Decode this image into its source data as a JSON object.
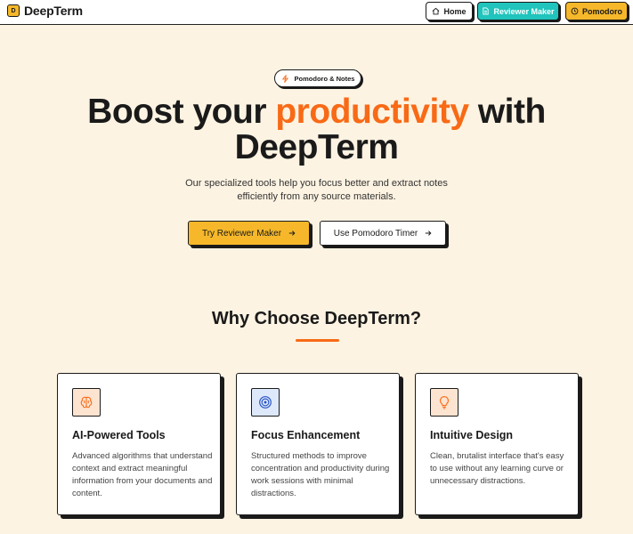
{
  "header": {
    "logo_text": "DeepTerm",
    "logo_mark": "D",
    "nav": {
      "home_label": "Home",
      "reviewer_label": "Reviewer Maker",
      "pomodoro_label": "Pomodoro"
    }
  },
  "hero": {
    "pill_label": "Pomodoro & Notes",
    "title_part1": "Boost your ",
    "title_accent": "productivity",
    "title_part2": " with",
    "title_line2": "DeepTerm",
    "subtitle": "Our specialized tools help you focus better and extract notes efficiently from any source materials.",
    "cta_primary": "Try Reviewer Maker",
    "cta_secondary": "Use Pomodoro Timer"
  },
  "features": {
    "title": "Why Choose DeepTerm?",
    "cards": [
      {
        "icon": "brain-icon",
        "title": "AI-Powered Tools",
        "desc": "Advanced algorithms that understand context and extract meaningful information from your documents and content."
      },
      {
        "icon": "target-icon",
        "title": "Focus Enhancement",
        "desc": "Structured methods to improve concentration and productivity during work sessions with minimal distractions."
      },
      {
        "icon": "lightbulb-icon",
        "title": "Intuitive Design",
        "desc": "Clean, brutalist interface that's easy to use without any learning curve or unnecessary distractions."
      }
    ]
  },
  "colors": {
    "background": "#fdf3e2",
    "accent_orange": "#f86a16",
    "yellow": "#f6b82a",
    "teal": "#20c4bc"
  }
}
